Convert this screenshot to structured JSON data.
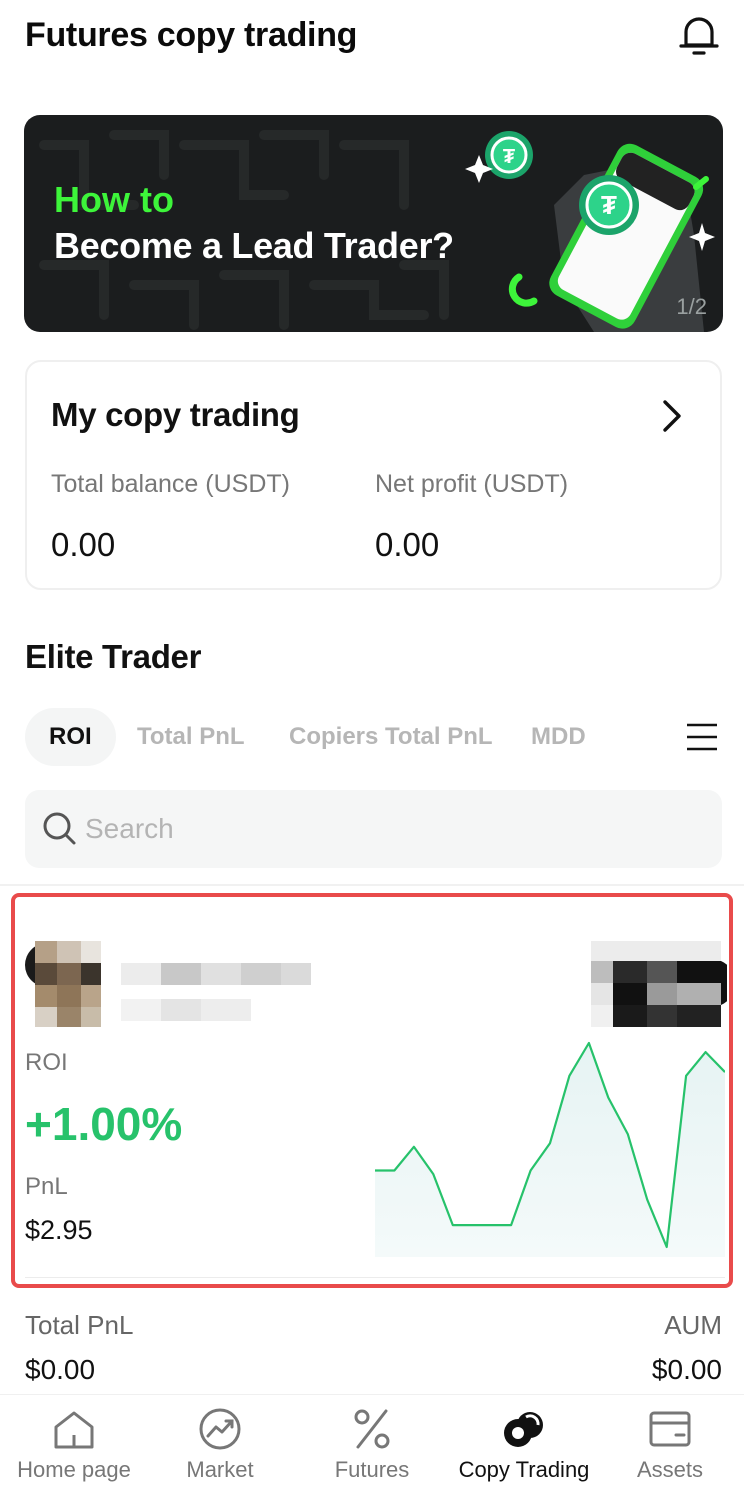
{
  "header": {
    "title": "Futures copy trading"
  },
  "banner": {
    "line1": "How to",
    "line2": "Become a Lead Trader?",
    "pager": "1/2"
  },
  "my_copy": {
    "title": "My copy trading",
    "total_balance_label": "Total balance (USDT)",
    "total_balance_value": "0.00",
    "net_profit_label": "Net profit (USDT)",
    "net_profit_value": "0.00"
  },
  "elite": {
    "title": "Elite Trader"
  },
  "tabs": [
    {
      "label": "ROI"
    },
    {
      "label": "Total PnL"
    },
    {
      "label": "Copiers Total PnL"
    },
    {
      "label": "MDD"
    }
  ],
  "search": {
    "placeholder": "Search"
  },
  "trader": {
    "roi_label": "ROI",
    "roi_value": "+1.00%",
    "pnl_label": "PnL",
    "pnl_value": "$2.95",
    "sparkline": [
      0.3,
      0.3,
      0.43,
      0.28,
      0.0,
      0.0,
      0.0,
      0.0,
      0.3,
      0.45,
      0.82,
      1.0,
      0.7,
      0.5,
      0.14,
      -0.12,
      0.82,
      0.95,
      0.84
    ]
  },
  "next_trader": {
    "total_pnl_label": "Total PnL",
    "total_pnl_value": "$0.00",
    "aum_label": "AUM",
    "aum_value": "$0.00"
  },
  "nav": {
    "items": [
      {
        "label": "Home page",
        "icon": "home-icon"
      },
      {
        "label": "Market",
        "icon": "market-icon"
      },
      {
        "label": "Futures",
        "icon": "futures-icon"
      },
      {
        "label": "Copy Trading",
        "icon": "copy-trading-icon",
        "active": true
      },
      {
        "label": "Assets",
        "icon": "assets-icon"
      }
    ]
  },
  "colors": {
    "accent_green": "#27c26b",
    "banner_green": "#3df53a",
    "highlight_red": "#e94b4b"
  }
}
